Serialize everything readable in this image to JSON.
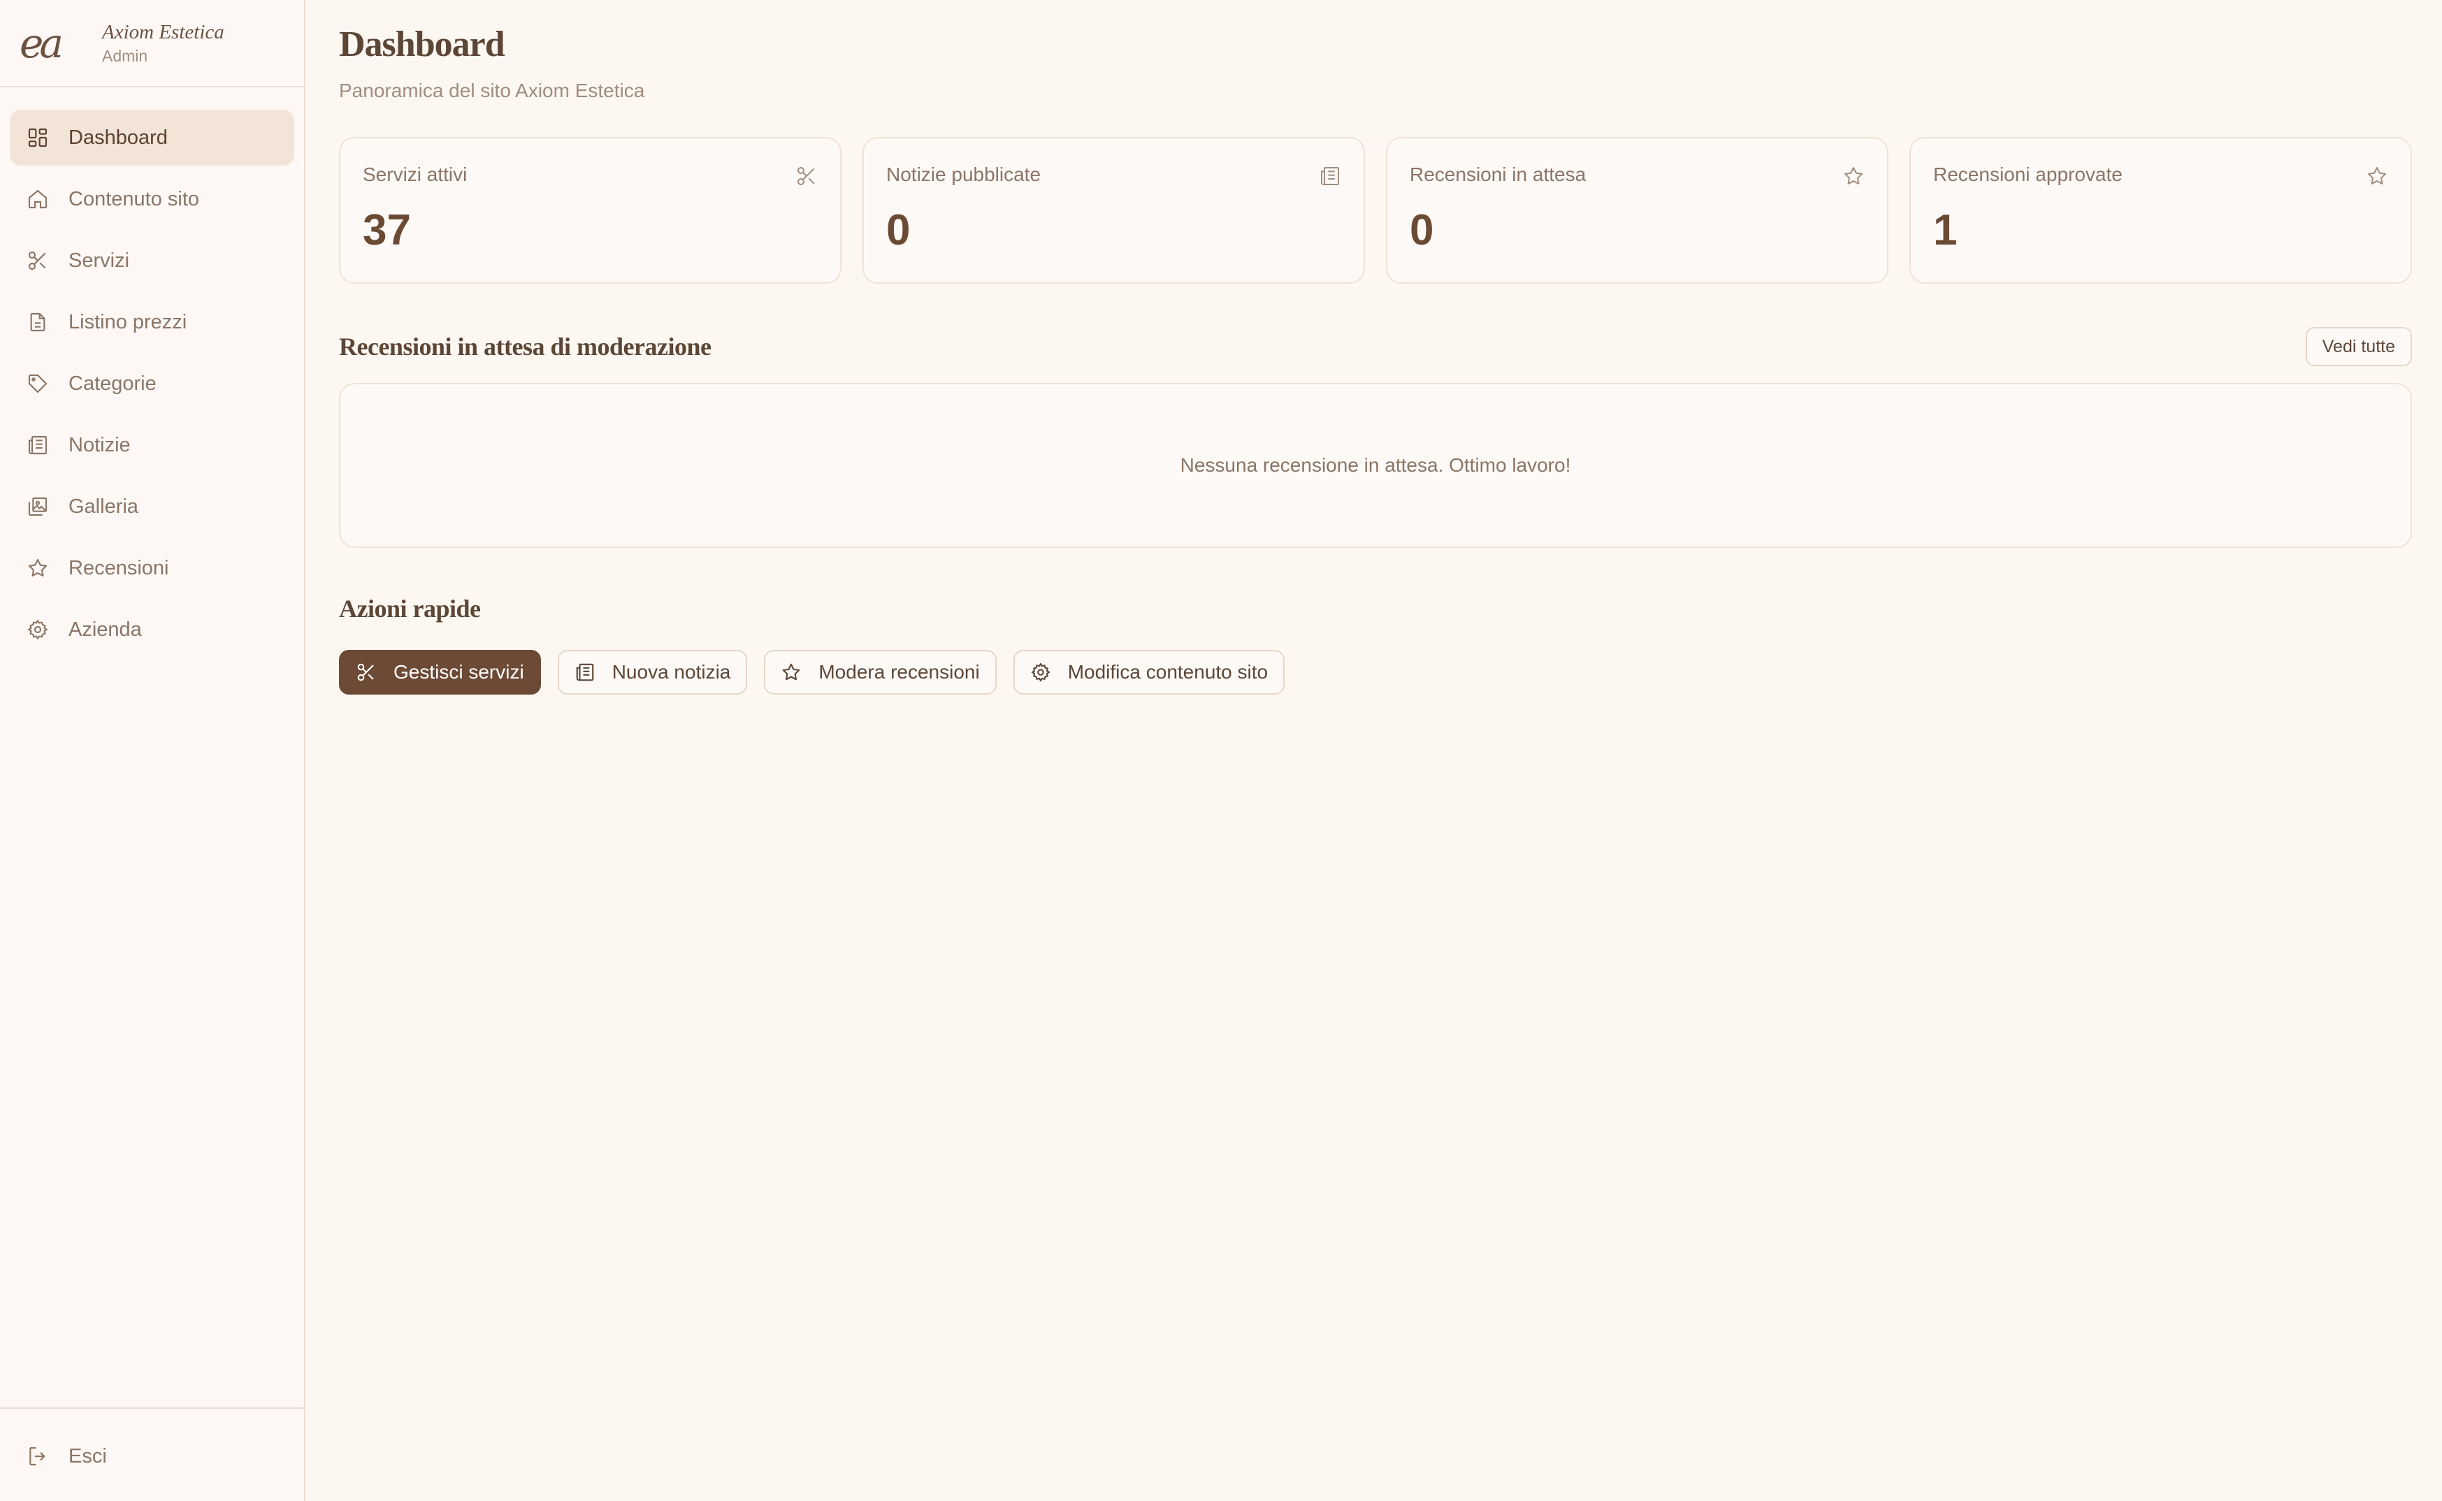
{
  "brand": {
    "logo": "ea",
    "name": "Axiom Estetica",
    "role": "Admin"
  },
  "sidebar": {
    "items": [
      {
        "label": "Dashboard",
        "icon": "dashboard-icon"
      },
      {
        "label": "Contenuto sito",
        "icon": "home-icon"
      },
      {
        "label": "Servizi",
        "icon": "scissors-icon"
      },
      {
        "label": "Listino prezzi",
        "icon": "document-icon"
      },
      {
        "label": "Categorie",
        "icon": "tag-icon"
      },
      {
        "label": "Notizie",
        "icon": "newspaper-icon"
      },
      {
        "label": "Galleria",
        "icon": "gallery-icon"
      },
      {
        "label": "Recensioni",
        "icon": "star-icon"
      },
      {
        "label": "Azienda",
        "icon": "gear-icon"
      }
    ],
    "logout": "Esci"
  },
  "header": {
    "title": "Dashboard",
    "subtitle": "Panoramica del sito Axiom Estetica"
  },
  "stats": [
    {
      "label": "Servizi attivi",
      "value": "37",
      "icon": "scissors-icon"
    },
    {
      "label": "Notizie pubblicate",
      "value": "0",
      "icon": "newspaper-icon"
    },
    {
      "label": "Recensioni in attesa",
      "value": "0",
      "icon": "star-icon"
    },
    {
      "label": "Recensioni approvate",
      "value": "1",
      "icon": "star-icon"
    }
  ],
  "pending": {
    "title": "Recensioni in attesa di moderazione",
    "view_all": "Vedi tutte",
    "empty": "Nessuna recensione in attesa. Ottimo lavoro!"
  },
  "quick": {
    "title": "Azioni rapide",
    "actions": [
      {
        "label": "Gestisci servizi",
        "icon": "scissors-icon"
      },
      {
        "label": "Nuova notizia",
        "icon": "newspaper-icon"
      },
      {
        "label": "Modera recensioni",
        "icon": "star-icon"
      },
      {
        "label": "Modifica contenuto sito",
        "icon": "gear-icon"
      }
    ]
  },
  "colors": {
    "accent": "#6d4a35",
    "background": "#fdf7f1",
    "active_nav": "#f3e4d8",
    "border": "#ecdfd4"
  }
}
